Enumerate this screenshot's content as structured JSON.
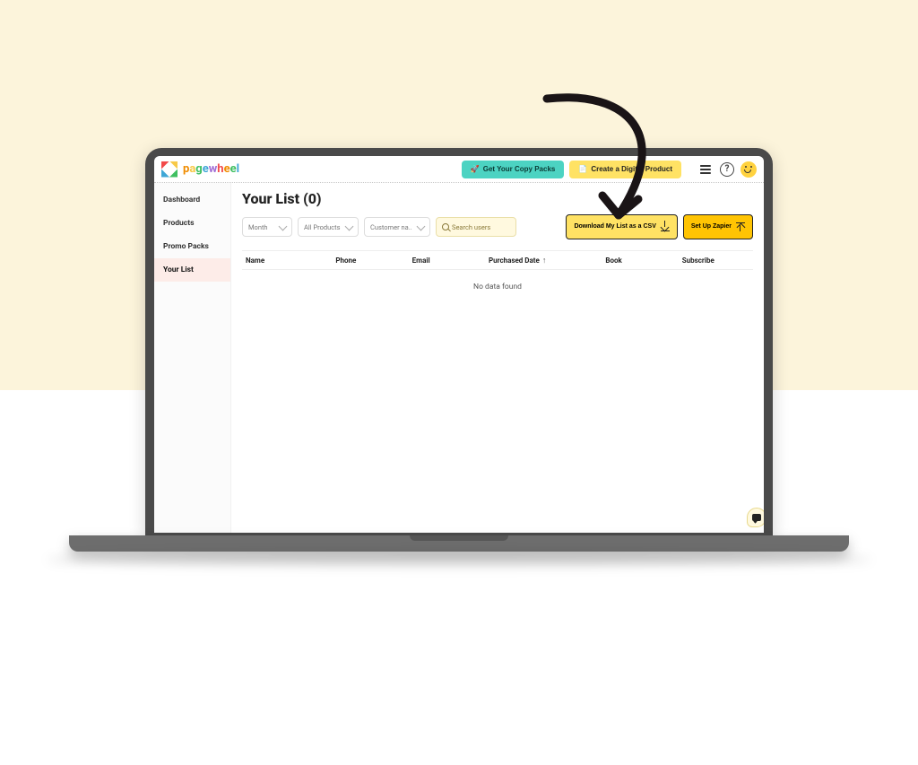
{
  "brand_letters": [
    "p",
    "a",
    "g",
    "e",
    "w",
    "h",
    "e",
    "e",
    "l"
  ],
  "header": {
    "copy_packs_label": "Get Your Copy Packs",
    "create_product_label": "Create a Digital Product"
  },
  "sidebar": {
    "items": [
      {
        "label": "Dashboard"
      },
      {
        "label": "Products"
      },
      {
        "label": "Promo Packs"
      },
      {
        "label": "Your List"
      }
    ],
    "active_index": 3
  },
  "page": {
    "title": "Your List (0)"
  },
  "filters": {
    "month_label": "Month",
    "products_label": "All Products",
    "customer_label": "Customer na..",
    "search_placeholder": "Search users"
  },
  "actions": {
    "download_csv_label": "Download My List as a CSV",
    "zapier_label": "Set Up Zapier"
  },
  "table": {
    "columns": {
      "name": "Name",
      "phone": "Phone",
      "email": "Email",
      "purchased_date": "Purchased Date",
      "book": "Book",
      "subscribe": "Subscribe"
    },
    "empty_message": "No data found"
  }
}
